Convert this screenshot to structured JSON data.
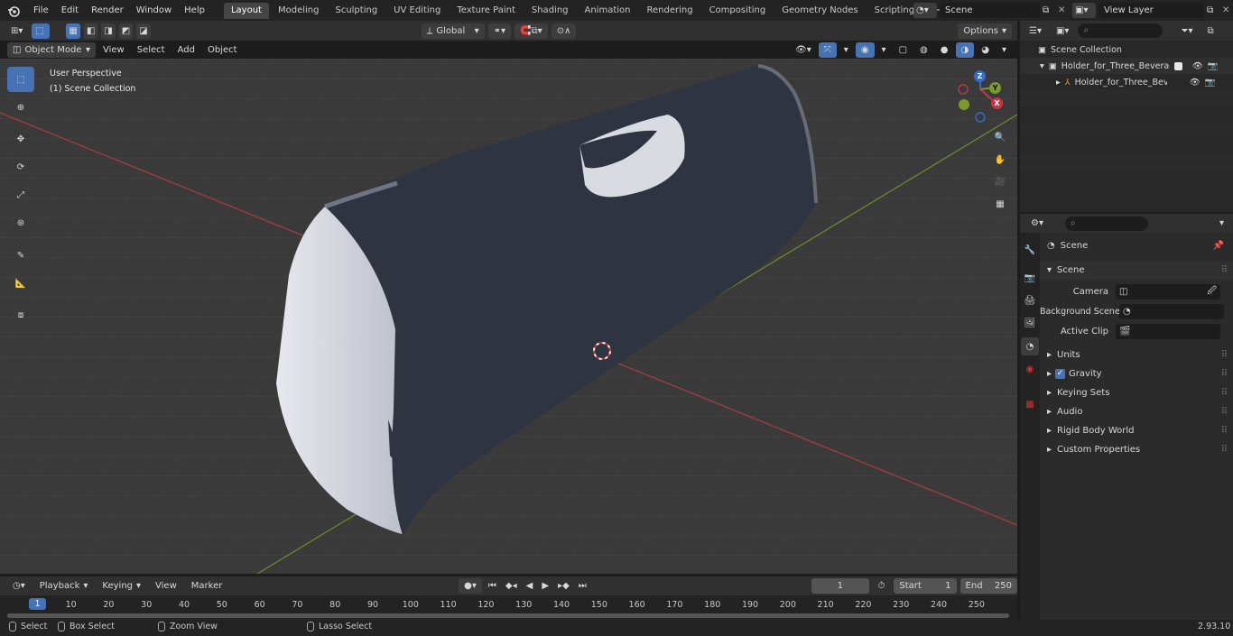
{
  "menu": {
    "items": [
      "File",
      "Edit",
      "Render",
      "Window",
      "Help"
    ]
  },
  "workspaces": [
    "Layout",
    "Modeling",
    "Sculpting",
    "UV Editing",
    "Texture Paint",
    "Shading",
    "Animation",
    "Rendering",
    "Compositing",
    "Geometry Nodes",
    "Scripting"
  ],
  "active_workspace": "Layout",
  "top_right": {
    "scene": "Scene",
    "view_layer": "View Layer"
  },
  "viewport_header": {
    "mode": "Object Mode",
    "menus": [
      "View",
      "Select",
      "Add",
      "Object"
    ],
    "orientation": "Global",
    "options": "Options"
  },
  "viewport": {
    "perspective": "User Perspective",
    "collection": "(1) Scene Collection"
  },
  "gizmo": {
    "x": "X",
    "y": "Y",
    "z": "Z"
  },
  "outliner": {
    "root": "Scene Collection",
    "items": [
      {
        "label": "Holder_for_Three_Beverage_I"
      },
      {
        "label": "Holder_for_Three_Bevera"
      }
    ]
  },
  "properties": {
    "context": "Scene",
    "panel": "Scene",
    "fields": [
      {
        "label": "Camera"
      },
      {
        "label": "Background Scene"
      },
      {
        "label": "Active Clip"
      }
    ],
    "subpanels": [
      "Units",
      "Gravity",
      "Keying Sets",
      "Audio",
      "Rigid Body World",
      "Custom Properties"
    ]
  },
  "timeline": {
    "menus": [
      "Playback",
      "Keying",
      "View",
      "Marker"
    ],
    "current_frame": "1",
    "start_label": "Start",
    "start": "1",
    "end_label": "End",
    "end": "250",
    "ticks": [
      "10",
      "20",
      "30",
      "40",
      "50",
      "60",
      "70",
      "80",
      "90",
      "100",
      "110",
      "120",
      "130",
      "140",
      "150",
      "160",
      "170",
      "180",
      "190",
      "200",
      "210",
      "220",
      "230",
      "240",
      "250"
    ],
    "frame_marker": "1"
  },
  "status": {
    "select": "Select",
    "box_select": "Box Select",
    "zoom_view": "Zoom View",
    "lasso_select": "Lasso Select",
    "version": "2.93.10"
  },
  "colors": {
    "accent": "#4772b3",
    "x_axis": "#a33b47",
    "y_axis": "#6c8a2a",
    "object": "#2e3440"
  }
}
